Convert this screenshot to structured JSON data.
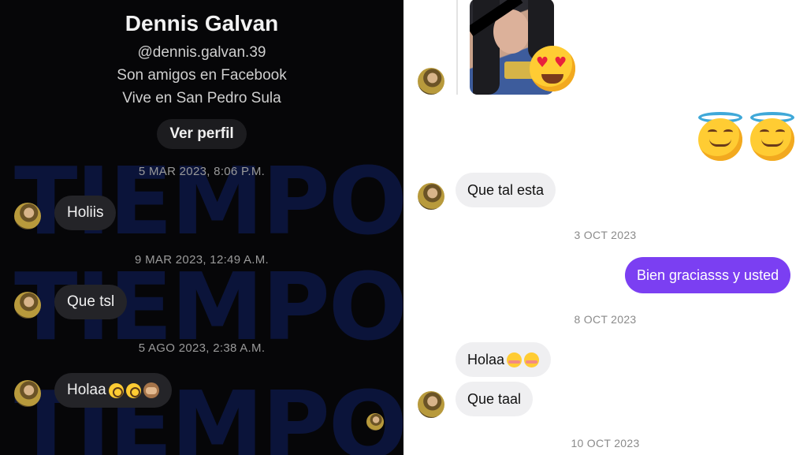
{
  "left_panel": {
    "watermark": [
      "TIEMPO",
      "TIEMPO",
      "TIEMPO"
    ],
    "profile": {
      "name": "Dennis Galvan",
      "handle": "@dennis.galvan.39",
      "friends_text": "Son amigos en Facebook",
      "city_text": "Vive en San Pedro Sula",
      "view_profile_label": "Ver perfil"
    },
    "messages": [
      {
        "date": "5 MAR 2023, 8:06 P.M.",
        "text": "Holiis",
        "emoji": []
      },
      {
        "date": "9 MAR 2023, 12:49 A.M.",
        "text": "Que tsl",
        "emoji": []
      },
      {
        "date": "5 AGO 2023, 2:38 A.M.",
        "text": "Holaa",
        "emoji": [
          "flushed-face-icon",
          "flushed-face-icon",
          "see-no-evil-monkey-icon"
        ]
      }
    ]
  },
  "right_panel": {
    "messages": {
      "que_tal": "Que tal esta",
      "bien": "Bien graciasss y usted",
      "holaa2": "Holaa",
      "que_taal": "Que taal"
    },
    "dates": {
      "d1": "3 OCT 2023",
      "d2": "8 OCT 2023",
      "d3": "10 OCT 2023"
    },
    "colors": {
      "outgoing_bubble": "#7b3ff2",
      "incoming_bubble": "#efeff1"
    }
  }
}
